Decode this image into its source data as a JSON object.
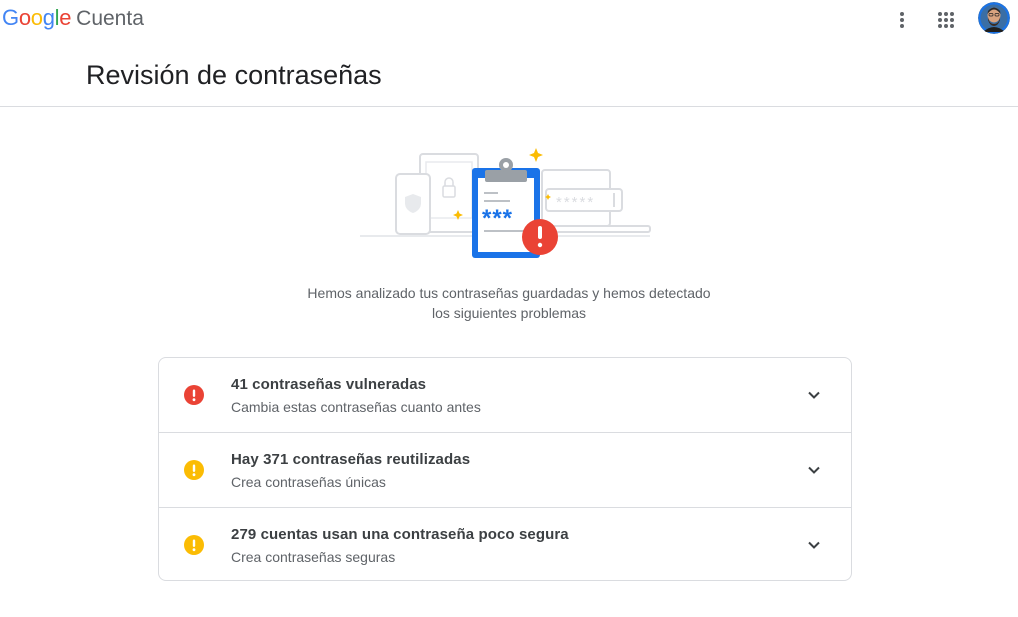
{
  "header": {
    "brand_google": [
      "G",
      "o",
      "o",
      "g",
      "l",
      "e"
    ],
    "brand_colors": [
      "#4285F4",
      "#EA4335",
      "#FBBC05",
      "#4285F4",
      "#34A853",
      "#EA4335"
    ],
    "product": "Cuenta",
    "icons": [
      "more-vert-icon",
      "apps-grid-icon",
      "avatar"
    ]
  },
  "page": {
    "title": "Revisión de contraseñas",
    "intro": "Hemos analizado tus contraseñas guardadas y hemos detectado los siguientes problemas"
  },
  "illustration": {
    "masked_password": "***",
    "icon": "clipboard-alert-illustration"
  },
  "issues": [
    {
      "title": "41 contraseñas vulneradas",
      "subtitle": "Cambia estas contraseñas cuanto antes",
      "severity": "critical",
      "color": "#EA4335",
      "icon": "alert-icon"
    },
    {
      "title": "Hay 371 contraseñas reutilizadas",
      "subtitle": "Crea contraseñas únicas",
      "severity": "warning",
      "color": "#FBBC04",
      "icon": "warning-icon"
    },
    {
      "title": "279 cuentas usan una contraseña poco segura",
      "subtitle": "Crea contraseñas seguras",
      "severity": "warning",
      "color": "#FBBC04",
      "icon": "warning-icon"
    }
  ]
}
